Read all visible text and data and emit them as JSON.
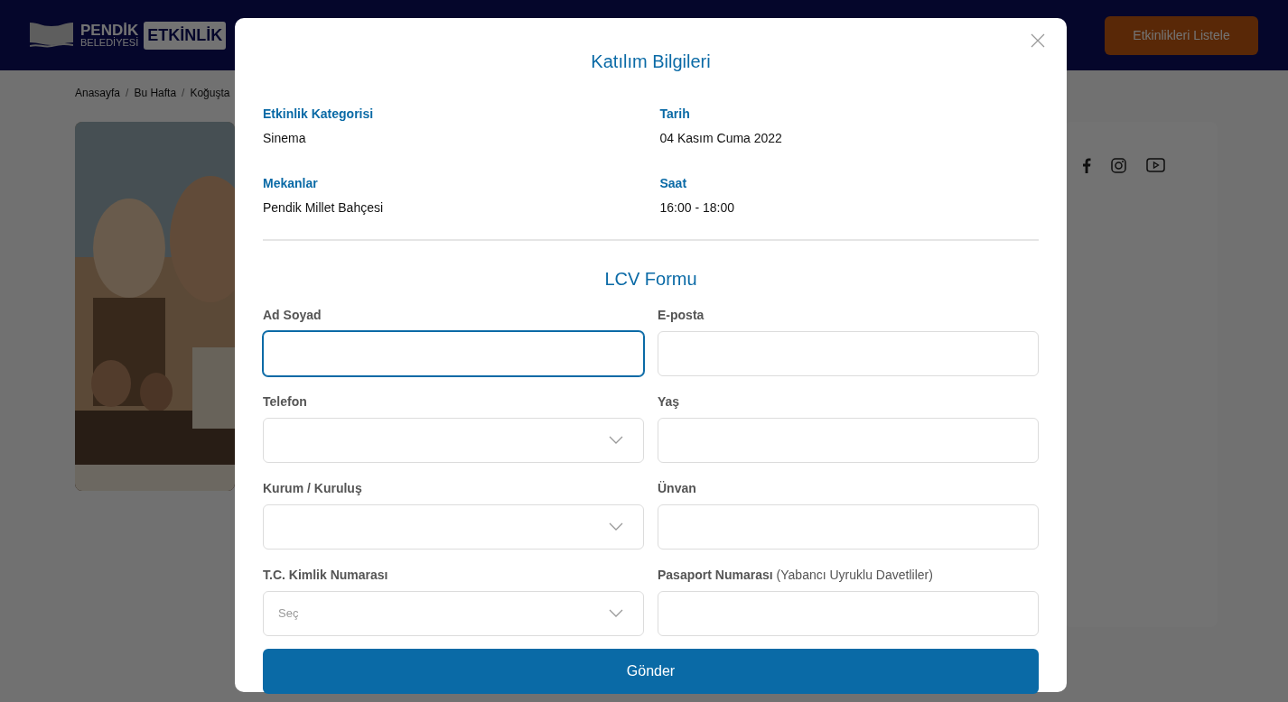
{
  "header": {
    "logo_name": "PENDİK",
    "logo_sub": "BELEDİYESİ",
    "logo_badge": "ETKİNLİK",
    "list_button": "Etkinlikleri Listele"
  },
  "breadcrumb": [
    {
      "kind": "link",
      "text": "Anasayfa"
    },
    {
      "kind": "separator",
      "text": "/"
    },
    {
      "kind": "link",
      "text": "Bu Hafta"
    },
    {
      "kind": "separator",
      "text": "/"
    },
    {
      "kind": "link",
      "text": "Koğuşta"
    }
  ],
  "modal": {
    "title": "Katılım Bilgileri",
    "info": [
      {
        "label": "Etkinlik Kategorisi",
        "value": "Sinema"
      },
      {
        "label": "Tarih",
        "value": "04 Kasım Cuma 2022"
      },
      {
        "label": "Mekanlar",
        "value": "Pendik Millet Bahçesi"
      },
      {
        "label": "Saat",
        "value": "16:00 - 18:00"
      }
    ],
    "form_title": "LCV Formu",
    "fields": [
      {
        "label": "Ad Soyad",
        "kind": "input",
        "focused": true
      },
      {
        "label": "E-posta",
        "kind": "input",
        "focused": false
      },
      {
        "label": "Telefon",
        "kind": "select",
        "focused": false
      },
      {
        "label": "Yaş",
        "kind": "input",
        "focused": false
      },
      {
        "label": "Kurum / Kuruluş",
        "kind": "select",
        "focused": false
      },
      {
        "label": "Ünvan",
        "kind": "input",
        "focused": false
      },
      {
        "label": "T.C. Kimlik Numarası",
        "kind": "select",
        "focused": false,
        "placeholder": "Seç"
      },
      {
        "label": "Pasaport Numarası",
        "note": "(Yabancı Uyruklu Davetliler)",
        "kind": "input",
        "focused": false
      }
    ],
    "submit": "Gönder"
  }
}
